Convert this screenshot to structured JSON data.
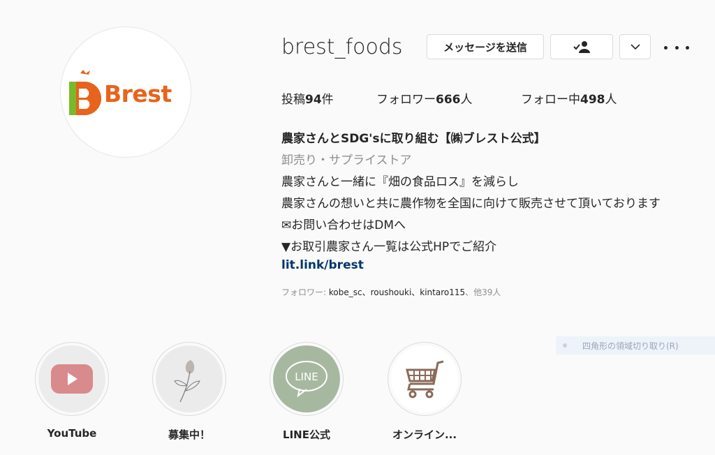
{
  "profile": {
    "logo_text": "Brest",
    "username": "brest_foods"
  },
  "actions": {
    "message_label": "メッセージを送信",
    "following_icon": "person-check-icon",
    "dropdown_icon": "chevron-down-icon",
    "more_icon": "more-dots-icon"
  },
  "stats": {
    "posts_label": "投稿",
    "posts_value": "94",
    "posts_unit": "件",
    "followers_label": "フォロワー",
    "followers_value": "666",
    "followers_unit": "人",
    "following_label": "フォロー中",
    "following_value": "498",
    "following_unit": "人"
  },
  "bio": {
    "name": "農家さんとSDG'sに取り組む【㈱ブレスト公式】",
    "category": "卸売り・サプライストア",
    "lines": [
      "農家さんと一緒に『畑の食品ロス』を減らし",
      "農家さんの想いと共に農作物を全国に向けて販売させて頂いております",
      "✉お問い合わせはDMへ",
      "▼お取引農家さん一覧は公式HPでご紹介"
    ],
    "link": "lit.link/brest"
  },
  "followed_by": {
    "prefix": "フォロワー: ",
    "names": "kobe_sc、roushouki、kintaro115",
    "suffix": "、他39人"
  },
  "overlay": {
    "snip_text": "四角形の領域切り取り(R)"
  },
  "highlights": [
    {
      "label": "YouTube",
      "icon": "youtube-icon"
    },
    {
      "label": "募集中！",
      "icon": "tulip-icon"
    },
    {
      "label": "LINE公式",
      "icon": "line-icon",
      "icon_text": "LINE"
    },
    {
      "label": "オンライン...",
      "icon": "shopping-cart-icon"
    }
  ],
  "colors": {
    "brand_orange": "#e8631c",
    "brand_green": "#7ab929",
    "link": "#00376b",
    "muted": "#8e8e8e"
  }
}
